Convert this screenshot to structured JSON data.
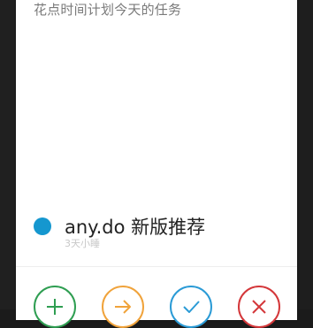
{
  "card": {
    "subtitle": "花点时间计划今天的任务"
  },
  "task": {
    "title": "any.do 新版推荐",
    "meta": "3天小睡",
    "dot_color": "#1597cf"
  },
  "actions": [
    {
      "name": "add",
      "icon": "plus-icon",
      "color": "#2f9e52"
    },
    {
      "name": "later",
      "icon": "arrow-right-icon",
      "color": "#f0a33b"
    },
    {
      "name": "done",
      "icon": "check-icon",
      "color": "#2b9bd6"
    },
    {
      "name": "dismiss",
      "icon": "close-icon",
      "color": "#d4373a"
    }
  ]
}
